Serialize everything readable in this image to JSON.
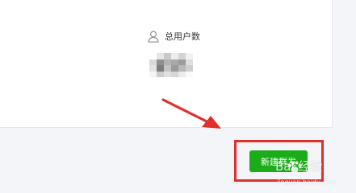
{
  "stats": {
    "total_users_label": "总用户数",
    "total_users_value_icon": "blurred-number-icon"
  },
  "actions": {
    "new_broadcast_label": "新建群发"
  },
  "colors": {
    "primary_button": "#1aad19",
    "highlight_box": "#e0302c",
    "annotation_arrow": "#e0302c"
  },
  "watermark": {
    "logo_text": "Bai 经验",
    "site_text": "jingyan.baidu.com"
  }
}
